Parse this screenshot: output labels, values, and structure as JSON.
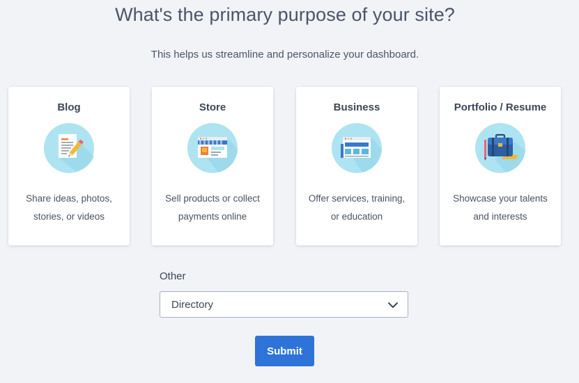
{
  "header": {
    "title": "What's the primary purpose of your site?",
    "subtitle": "This helps us streamline and personalize your dashboard."
  },
  "cards": [
    {
      "title": "Blog",
      "desc_line1": "Share ideas, photos,",
      "desc_line2": "stories, or videos",
      "icon": "blog-document-pencil-icon"
    },
    {
      "title": "Store",
      "desc_line1": "Sell products or collect",
      "desc_line2": "payments online",
      "icon": "storefront-icon"
    },
    {
      "title": "Business",
      "desc_line1": "Offer services, training,",
      "desc_line2": "or education",
      "icon": "business-browser-window-icon"
    },
    {
      "title": "Portfolio / Resume",
      "desc_line1": "Showcase your talents",
      "desc_line2": "and interests",
      "icon": "portfolio-briefcase-icon"
    }
  ],
  "other": {
    "label": "Other",
    "selected": "Directory"
  },
  "submit": {
    "label": "Submit"
  },
  "colors": {
    "background": "#f1f3f7",
    "card": "#ffffff",
    "icon_circle": "#aee3f2",
    "accent_button": "#2e74d8",
    "text": "#3c4656"
  }
}
